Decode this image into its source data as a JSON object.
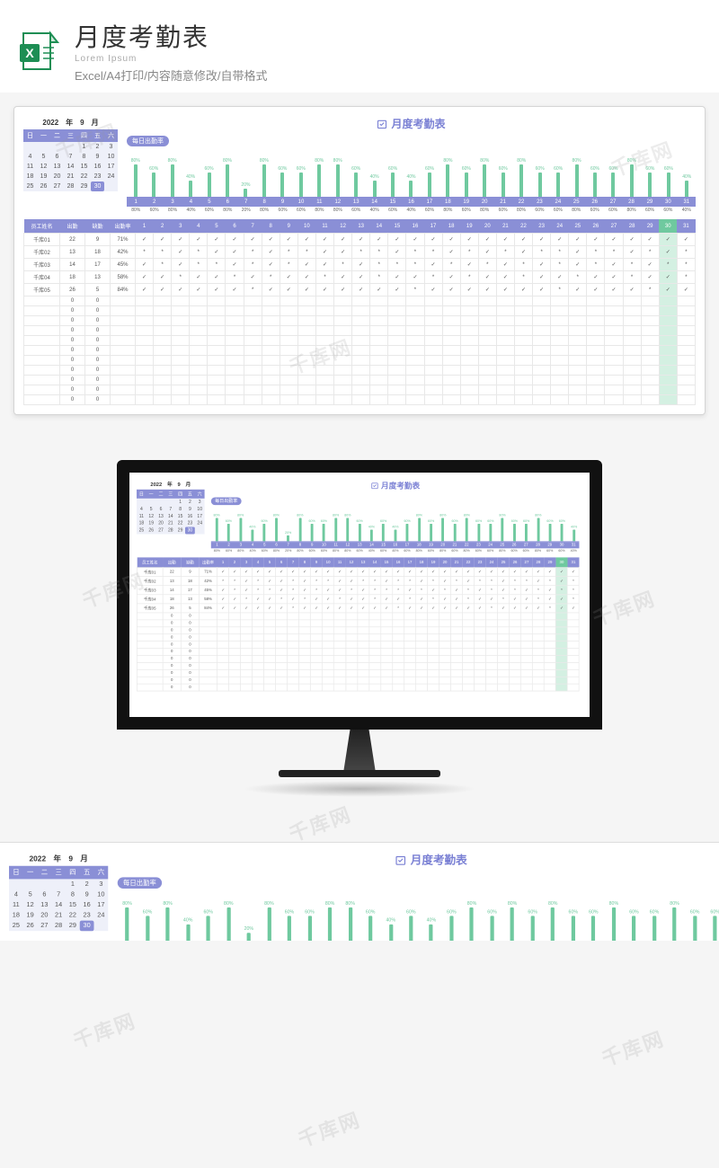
{
  "header": {
    "title": "月度考勤表",
    "lorem": "Lorem Ipsum",
    "subtitle": "Excel/A4打印/内容随意修改/自带格式"
  },
  "calendar": {
    "header": "2022　年　9　月",
    "weekdays": [
      "日",
      "一",
      "二",
      "三",
      "四",
      "五",
      "六"
    ],
    "cells": [
      "",
      "",
      "",
      "",
      "1",
      "2",
      "3",
      "4",
      "5",
      "6",
      "7",
      "8",
      "9",
      "10",
      "11",
      "12",
      "13",
      "14",
      "15",
      "16",
      "17",
      "18",
      "19",
      "20",
      "21",
      "22",
      "23",
      "24",
      "25",
      "26",
      "27",
      "28",
      "29",
      "30",
      ""
    ],
    "today_index": 33
  },
  "sheet": {
    "title": "月度考勤表",
    "badge": "每日出勤率"
  },
  "chart_data": {
    "type": "bar",
    "title": "每日出勤率",
    "xlabel": "日",
    "ylabel": "出勤率",
    "ylim": [
      0,
      100
    ],
    "categories": [
      1,
      2,
      3,
      4,
      5,
      6,
      7,
      8,
      9,
      10,
      11,
      12,
      13,
      14,
      15,
      16,
      17,
      18,
      19,
      20,
      21,
      22,
      23,
      24,
      25,
      26,
      27,
      28,
      29,
      30,
      31
    ],
    "values": [
      80,
      60,
      80,
      40,
      60,
      80,
      20,
      80,
      60,
      60,
      80,
      80,
      60,
      40,
      60,
      40,
      60,
      80,
      60,
      80,
      60,
      80,
      60,
      60,
      80,
      60,
      60,
      80,
      60,
      60,
      40
    ],
    "value_labels": [
      "80%",
      "60%",
      "80%",
      "40%",
      "60%",
      "80%",
      "20%",
      "80%",
      "60%",
      "60%",
      "80%",
      "80%",
      "60%",
      "40%",
      "60%",
      "40%",
      "60%",
      "80%",
      "60%",
      "80%",
      "60%",
      "80%",
      "60%",
      "60%",
      "80%",
      "60%",
      "60%",
      "80%",
      "60%",
      "60%",
      "40%"
    ]
  },
  "table": {
    "headers": {
      "name": "员工姓名",
      "present": "出勤",
      "absent": "缺勤",
      "rate": "出勤率"
    },
    "day_count": 31,
    "highlight_day": 30,
    "rows": [
      {
        "name": "千库01",
        "present": 22,
        "absent": 9,
        "rate": "71%",
        "marks": [
          "✓",
          "✓",
          "✓",
          "✓",
          "✓",
          "✓",
          "✓",
          "✓",
          "✓",
          "✓",
          "✓",
          "✓",
          "✓",
          "✓",
          "✓",
          "✓",
          "✓",
          "✓",
          "✓",
          "✓",
          "✓",
          "✓",
          "✓",
          "✓",
          "✓",
          "✓",
          "✓",
          "✓",
          "✓",
          "✓",
          "✓"
        ]
      },
      {
        "name": "千库02",
        "present": 13,
        "absent": 18,
        "rate": "42%",
        "marks": [
          "*",
          "*",
          "✓",
          "*",
          "✓",
          "✓",
          "*",
          "✓",
          "*",
          "*",
          "✓",
          "✓",
          "*",
          "*",
          "✓",
          "*",
          "*",
          "✓",
          "*",
          "✓",
          "*",
          "✓",
          "*",
          "*",
          "✓",
          "*",
          "*",
          "✓",
          "*",
          "✓",
          "*"
        ]
      },
      {
        "name": "千库03",
        "present": 14,
        "absent": 17,
        "rate": "45%",
        "marks": [
          "✓",
          "*",
          "✓",
          "*",
          "*",
          "✓",
          "*",
          "✓",
          "*",
          "✓",
          "✓",
          "*",
          "✓",
          "*",
          "*",
          "*",
          "✓",
          "*",
          "✓",
          "*",
          "✓",
          "*",
          "✓",
          "*",
          "✓",
          "*",
          "✓",
          "*",
          "✓",
          "*",
          "*"
        ]
      },
      {
        "name": "千库04",
        "present": 18,
        "absent": 13,
        "rate": "58%",
        "marks": [
          "✓",
          "✓",
          "*",
          "✓",
          "✓",
          "*",
          "✓",
          "*",
          "✓",
          "✓",
          "*",
          "✓",
          "✓",
          "*",
          "✓",
          "✓",
          "*",
          "✓",
          "*",
          "✓",
          "✓",
          "*",
          "✓",
          "✓",
          "*",
          "✓",
          "✓",
          "*",
          "✓",
          "✓",
          "*"
        ]
      },
      {
        "name": "千库05",
        "present": 26,
        "absent": 5,
        "rate": "84%",
        "marks": [
          "✓",
          "✓",
          "✓",
          "✓",
          "✓",
          "✓",
          "*",
          "✓",
          "✓",
          "✓",
          "✓",
          "✓",
          "✓",
          "✓",
          "✓",
          "*",
          "✓",
          "✓",
          "✓",
          "✓",
          "✓",
          "✓",
          "✓",
          "*",
          "✓",
          "✓",
          "✓",
          "✓",
          "*",
          "✓",
          "✓"
        ]
      }
    ],
    "empty_row_count": 11
  },
  "watermark": "千库网"
}
